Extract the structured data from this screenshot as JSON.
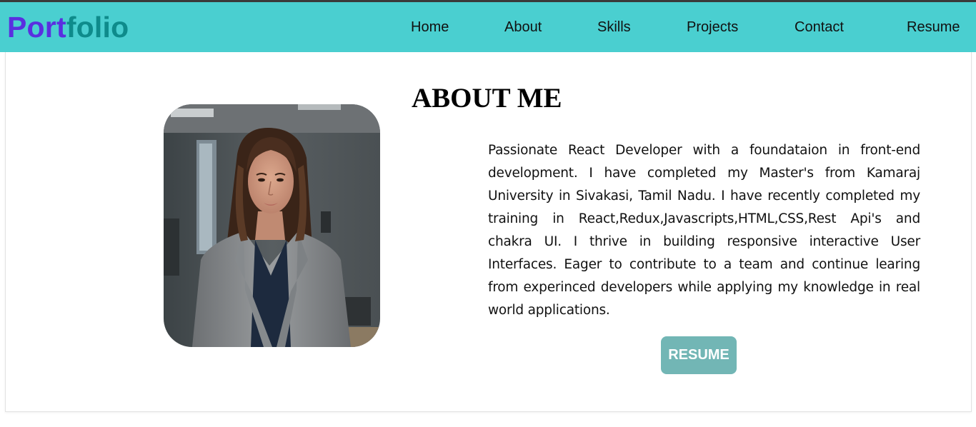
{
  "nav": {
    "logo_part1": "Port",
    "logo_part2": "folio",
    "links": [
      "Home",
      "About",
      "Skills",
      "Projects",
      "Contact",
      "Resume"
    ]
  },
  "about": {
    "title": "ABOUT ME",
    "photo_icon": "profile-photo",
    "paragraph": "Passionate React Developer with a foundataion in front-end development. I have completed my Master's from Kamaraj University in Sivakasi, Tamil Nadu. I have recently completed my training in React,Redux,Javascripts,HTML,CSS,Rest Api's and chakra UI. I thrive in building responsive interactive User Interfaces. Eager to contribute to a team and continue learing from experinced developers while applying my knowledge in real world applications.",
    "resume_button": "RESUME"
  },
  "colors": {
    "navbar": "#4acfd0",
    "logo_port": "#5a2fe0",
    "logo_folio": "#0e8b8b",
    "button": "#72b6b5"
  }
}
